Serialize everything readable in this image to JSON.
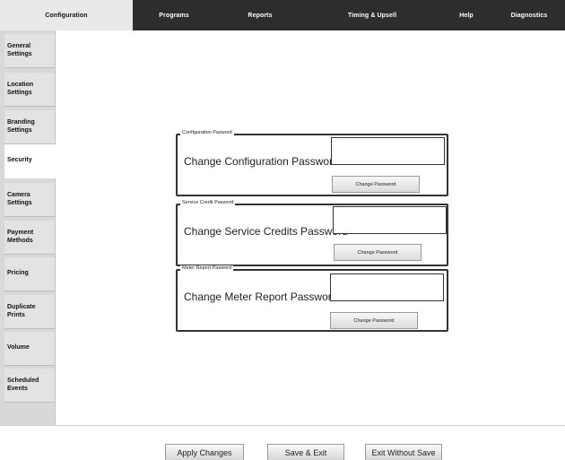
{
  "top_tabs": [
    {
      "label": "Configuration"
    },
    {
      "label": "Programs"
    },
    {
      "label": "Reports"
    },
    {
      "label": "Timing & Upsell"
    },
    {
      "label": "Help"
    },
    {
      "label": "Diagnostics"
    }
  ],
  "sidebar": {
    "items": [
      {
        "label": "General Settings"
      },
      {
        "label": "Location Settings"
      },
      {
        "label": "Branding Settings"
      },
      {
        "label": "Security"
      },
      {
        "label": "Camera Settings"
      },
      {
        "label": "Payment Methods"
      },
      {
        "label": "Pricing"
      },
      {
        "label": "Duplicate Prints"
      },
      {
        "label": "Volume"
      },
      {
        "label": "Scheduled Events"
      }
    ]
  },
  "security": {
    "configuration": {
      "legend": "Configuration Pasword",
      "label": "Change Configuration Password",
      "value": "",
      "button": "Change Password"
    },
    "service_credit": {
      "legend": "Service Credit Pasword",
      "label": "Change Service Credits Password",
      "value": "",
      "button": "Change Password"
    },
    "meter_report": {
      "legend": "Meter Report Pasword",
      "label": "Change Meter Report Password",
      "value": "",
      "button": "Change Password"
    }
  },
  "footer": {
    "apply": "Apply Changes",
    "save_exit": "Save & Exit",
    "exit_no_save": "Exit Without Save"
  }
}
